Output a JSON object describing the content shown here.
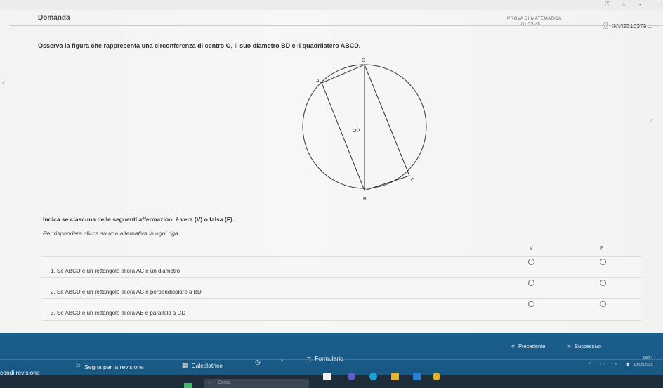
{
  "header": {
    "question_label": "Domanda",
    "exam_title": "PROVA DI MATEMATICA",
    "timer": "01:22:45",
    "user_code": "INVI2510379 ..."
  },
  "question": {
    "prompt": "Osserva la figura che rappresenta una circonferenza di centro O, il suo diametro BD e il quadrilatero ABCD.",
    "instruction": "Indica se ciascuna delle seguenti affermazioni è vera (V) o falsa (F).",
    "sub_instruction": "Per rispondere clicca su una alternativa in ogni riga.",
    "figure_labels": {
      "d": "D",
      "a": "A",
      "o": "O",
      "c": "C",
      "b": "B"
    },
    "columns": {
      "true": "V",
      "false": "F"
    },
    "rows": [
      {
        "label": "1. Se ABCD è un rettangolo allora AC è un diametro"
      },
      {
        "label": "2. Se ABCD è un rettangolo allora AC è perpendicolare a BD"
      },
      {
        "label": "3. Se ABCD è un rettangolo allora AB è parallelo a CD"
      }
    ]
  },
  "nav": {
    "previous": "Precedente",
    "next": "Successivo",
    "review_list": "condi revisione",
    "mark_review": "Segna per la revisione",
    "calculator": "Calcolatrice",
    "formulario_symbol": "π",
    "formulario": "Formulario"
  },
  "system": {
    "time": "08:54",
    "date": "19/05/2025",
    "search_placeholder": "Cerca"
  },
  "icons": [
    "left-arrow-icon",
    "user-icon",
    "chevron-down-icon",
    "flag-icon",
    "calculator-icon",
    "clock-icon",
    "formula-icon",
    "prev-icon",
    "next-icon"
  ],
  "colors": {
    "navbar": "#1b5f8e",
    "taskbar": "#1f2d3a"
  }
}
